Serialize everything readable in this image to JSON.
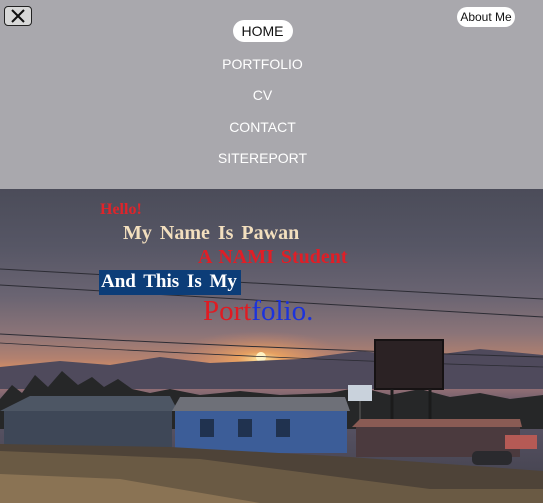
{
  "header": {
    "close_label": "close",
    "about_label": "About Me"
  },
  "nav": {
    "items": [
      {
        "label": "HOME",
        "active": true
      },
      {
        "label": "PORTFOLIO",
        "active": false
      },
      {
        "label": "CV",
        "active": false
      },
      {
        "label": "CONTACT",
        "active": false
      },
      {
        "label": "SITEREPORT",
        "active": false
      }
    ]
  },
  "hero": {
    "greeting": "Hello!",
    "name_line": "My Name Is Pawan",
    "role_line": "A NAMI Student",
    "this_line": "And This Is My",
    "portfolio_part1": "Port",
    "portfolio_part2": "folio."
  },
  "colors": {
    "nav_bg": "#a9a8ad",
    "greeting": "#e0242a",
    "name": "#f3dfbe",
    "role": "#e01e26",
    "highlight_bg": "#0c3d78",
    "portfolio_red": "#e01b22",
    "portfolio_blue": "#1c33dc"
  }
}
